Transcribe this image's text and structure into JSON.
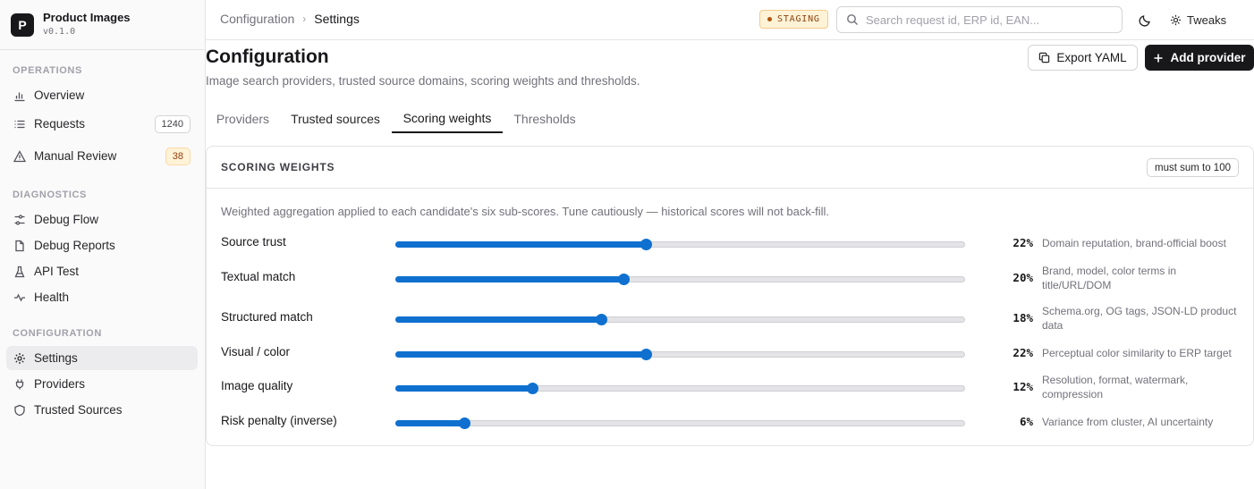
{
  "app": {
    "logo_letter": "P",
    "name": "Product Images",
    "version": "v0.1.0"
  },
  "sidebar": {
    "sections": [
      {
        "label": "OPERATIONS",
        "items": [
          {
            "label": "Overview",
            "icon": "bar-chart-icon"
          },
          {
            "label": "Requests",
            "icon": "list-icon",
            "count": "1240"
          },
          {
            "label": "Manual Review",
            "icon": "warning-icon",
            "count": "38"
          }
        ]
      },
      {
        "label": "DIAGNOSTICS",
        "items": [
          {
            "label": "Debug Flow",
            "icon": "sliders-icon"
          },
          {
            "label": "Debug Reports",
            "icon": "file-icon"
          },
          {
            "label": "API Test",
            "icon": "flask-icon"
          },
          {
            "label": "Health",
            "icon": "pulse-icon"
          }
        ]
      },
      {
        "label": "CONFIGURATION",
        "items": [
          {
            "label": "Settings",
            "icon": "gear-icon",
            "active": true
          },
          {
            "label": "Providers",
            "icon": "plug-icon"
          },
          {
            "label": "Trusted Sources",
            "icon": "shield-icon"
          }
        ]
      }
    ]
  },
  "header": {
    "breadcrumb": [
      "Configuration",
      "Settings"
    ],
    "env_badge": "STAGING",
    "search_placeholder": "Search request id, ERP id, EAN...",
    "tweaks_label": "Tweaks"
  },
  "page": {
    "title": "Configuration",
    "subtitle": "Image search providers, trusted source domains, scoring weights and thresholds.",
    "export_label": "Export YAML",
    "add_label": "Add provider"
  },
  "tabs": [
    {
      "label": "Providers"
    },
    {
      "label": "Trusted sources"
    },
    {
      "label": "Scoring weights",
      "active": true
    },
    {
      "label": "Thresholds"
    }
  ],
  "card": {
    "title": "SCORING WEIGHTS",
    "badge": "must sum to 100",
    "description": "Weighted aggregation applied to each candidate's six sub-scores. Tune cautiously — historical scores will not back-fill.",
    "weights": [
      {
        "label": "Source trust",
        "value": 22,
        "display": "22%",
        "note": "Domain reputation, brand-official boost"
      },
      {
        "label": "Textual match",
        "value": 20,
        "display": "20%",
        "note": "Brand, model, color terms in title/URL/DOM"
      },
      {
        "label": "Structured match",
        "value": 18,
        "display": "18%",
        "note": "Schema.org, OG tags, JSON-LD product data"
      },
      {
        "label": "Visual / color",
        "value": 22,
        "display": "22%",
        "note": "Perceptual color similarity to ERP target"
      },
      {
        "label": "Image quality",
        "value": 12,
        "display": "12%",
        "note": "Resolution, format, watermark, compression"
      },
      {
        "label": "Risk penalty (inverse)",
        "value": 6,
        "display": "6%",
        "note": "Variance from cluster, AI uncertainty"
      }
    ]
  },
  "colors": {
    "accent": "#0f70d0",
    "sidebar_bg": "#fafafa",
    "staging_bg": "#fef3d7"
  }
}
